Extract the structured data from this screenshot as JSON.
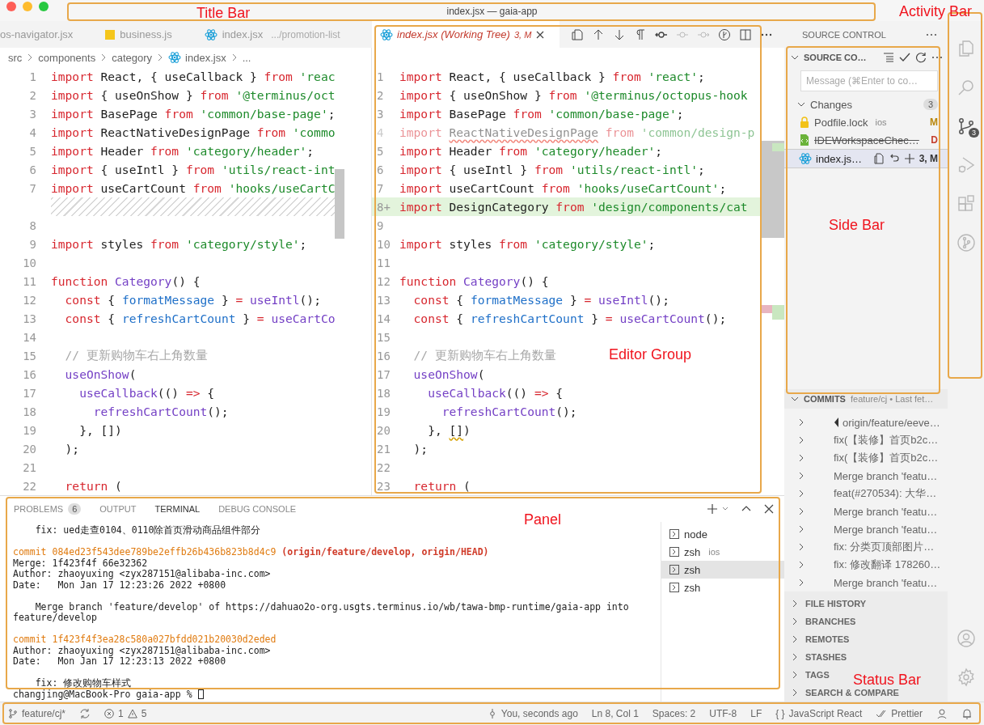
{
  "window": {
    "title": "index.jsx — gaia-app"
  },
  "editor": {
    "left_tabs": [
      {
        "label": "os-navigator.jsx",
        "kind": "plain",
        "selected": false
      },
      {
        "label": "business.js",
        "kind": "js",
        "selected": false
      },
      {
        "label": "index.jsx",
        "detail": ".../promotion-list",
        "kind": "react",
        "selected": false
      }
    ],
    "right_tab": {
      "label": "index.jsx (Working Tree)",
      "status": "3, M",
      "selected": true
    },
    "breadcrumb": [
      {
        "text": "src",
        "kind": "folder"
      },
      {
        "text": "components",
        "kind": "folder"
      },
      {
        "text": "category",
        "kind": "folder"
      },
      {
        "text": "index.jsx",
        "kind": "file"
      },
      {
        "text": "...",
        "kind": "symbol"
      }
    ],
    "left_lines": [
      {
        "n": "1",
        "kind": "code",
        "tokens": [
          {
            "kind": "keyword",
            "text": "import"
          },
          {
            "kind": "plain",
            "text": " React, { useCallback } "
          },
          {
            "kind": "keyword",
            "text": "from"
          },
          {
            "kind": "string",
            "text": " 'reac"
          }
        ]
      },
      {
        "n": "2",
        "kind": "code",
        "tokens": [
          {
            "kind": "keyword",
            "text": "import"
          },
          {
            "kind": "plain",
            "text": " { useOnShow } "
          },
          {
            "kind": "keyword",
            "text": "from"
          },
          {
            "kind": "string",
            "text": " '@terminus/oct"
          }
        ]
      },
      {
        "n": "3",
        "kind": "code",
        "tokens": [
          {
            "kind": "keyword",
            "text": "import"
          },
          {
            "kind": "plain",
            "text": " BasePage "
          },
          {
            "kind": "keyword",
            "text": "from"
          },
          {
            "kind": "string",
            "text": " 'common/base-page'"
          },
          {
            "kind": "plain",
            "text": ";"
          }
        ]
      },
      {
        "n": "4",
        "kind": "code",
        "tokens": [
          {
            "kind": "keyword",
            "text": "import"
          },
          {
            "kind": "plain",
            "text": " ReactNativeDesignPage "
          },
          {
            "kind": "keyword",
            "text": "from"
          },
          {
            "kind": "string",
            "text": " 'commo"
          }
        ]
      },
      {
        "n": "5",
        "kind": "code",
        "tokens": [
          {
            "kind": "keyword",
            "text": "import"
          },
          {
            "kind": "plain",
            "text": " Header "
          },
          {
            "kind": "keyword",
            "text": "from"
          },
          {
            "kind": "string",
            "text": " 'category/header'"
          },
          {
            "kind": "plain",
            "text": ";"
          }
        ]
      },
      {
        "n": "6",
        "kind": "code",
        "tokens": [
          {
            "kind": "keyword",
            "text": "import"
          },
          {
            "kind": "plain",
            "text": " { useIntl } "
          },
          {
            "kind": "keyword",
            "text": "from"
          },
          {
            "kind": "string",
            "text": " 'utils/react-int"
          }
        ]
      },
      {
        "n": "7",
        "kind": "code",
        "tokens": [
          {
            "kind": "keyword",
            "text": "import"
          },
          {
            "kind": "plain",
            "text": " useCartCount "
          },
          {
            "kind": "keyword",
            "text": "from"
          },
          {
            "kind": "string",
            "text": " 'hooks/useCartC"
          }
        ]
      },
      {
        "kind": "filler"
      },
      {
        "n": "8",
        "kind": "code"
      },
      {
        "n": "9",
        "kind": "code",
        "tokens": [
          {
            "kind": "keyword",
            "text": "import"
          },
          {
            "kind": "plain",
            "text": " styles "
          },
          {
            "kind": "keyword",
            "text": "from"
          },
          {
            "kind": "string",
            "text": " 'category/style'"
          },
          {
            "kind": "plain",
            "text": ";"
          }
        ]
      },
      {
        "n": "10",
        "kind": "code"
      },
      {
        "n": "11",
        "kind": "code",
        "tokens": [
          {
            "kind": "keyword",
            "text": "function"
          },
          {
            "kind": "function",
            "text": " Category"
          },
          {
            "kind": "plain",
            "text": "() {"
          }
        ]
      },
      {
        "n": "12",
        "kind": "code",
        "tokens": [
          {
            "kind": "keyword",
            "text": "  const"
          },
          {
            "kind": "plain",
            "text": " { "
          },
          {
            "kind": "variable",
            "text": "formatMessage"
          },
          {
            "kind": "plain",
            "text": " } "
          },
          {
            "kind": "keyword",
            "text": "="
          },
          {
            "kind": "function",
            "text": " useIntl"
          },
          {
            "kind": "plain",
            "text": "();"
          }
        ]
      },
      {
        "n": "13",
        "kind": "code",
        "tokens": [
          {
            "kind": "keyword",
            "text": "  const"
          },
          {
            "kind": "plain",
            "text": " { "
          },
          {
            "kind": "variable",
            "text": "refreshCartCount"
          },
          {
            "kind": "plain",
            "text": " } "
          },
          {
            "kind": "keyword",
            "text": "="
          },
          {
            "kind": "function",
            "text": " useCartCo"
          }
        ]
      },
      {
        "n": "14",
        "kind": "code"
      },
      {
        "n": "15",
        "kind": "code",
        "tokens": [
          {
            "kind": "comment",
            "text": "  // 更新购物车右上角数量"
          }
        ]
      },
      {
        "n": "16",
        "kind": "code",
        "tokens": [
          {
            "kind": "function",
            "text": "  useOnShow"
          },
          {
            "kind": "plain",
            "text": "("
          }
        ]
      },
      {
        "n": "17",
        "kind": "code",
        "tokens": [
          {
            "kind": "function",
            "text": "    useCallback"
          },
          {
            "kind": "plain",
            "text": "(() "
          },
          {
            "kind": "keyword",
            "text": "=>"
          },
          {
            "kind": "plain",
            "text": " {"
          }
        ]
      },
      {
        "n": "18",
        "kind": "code",
        "tokens": [
          {
            "kind": "function",
            "text": "      refreshCartCount"
          },
          {
            "kind": "plain",
            "text": "();"
          }
        ]
      },
      {
        "n": "19",
        "kind": "code",
        "tokens": [
          {
            "kind": "plain",
            "text": "    }, [])"
          }
        ]
      },
      {
        "n": "20",
        "kind": "code",
        "tokens": [
          {
            "kind": "plain",
            "text": "  );"
          }
        ]
      },
      {
        "n": "21",
        "kind": "code"
      },
      {
        "n": "22",
        "kind": "code",
        "tokens": [
          {
            "kind": "keyword",
            "text": "  return"
          },
          {
            "kind": "plain",
            "text": " ("
          }
        ]
      }
    ],
    "right_lines": [
      {
        "n": "1",
        "kind": "code",
        "tokens": [
          {
            "kind": "keyword",
            "text": "import"
          },
          {
            "kind": "plain",
            "text": " React, { useCallback } "
          },
          {
            "kind": "keyword",
            "text": "from"
          },
          {
            "kind": "string",
            "text": " 'react'"
          },
          {
            "kind": "plain",
            "text": ";"
          }
        ]
      },
      {
        "n": "2",
        "kind": "code",
        "tokens": [
          {
            "kind": "keyword",
            "text": "import"
          },
          {
            "kind": "plain",
            "text": " { useOnShow } "
          },
          {
            "kind": "keyword",
            "text": "from"
          },
          {
            "kind": "string",
            "text": " '@terminus/octopus-hook"
          }
        ]
      },
      {
        "n": "3",
        "kind": "code",
        "tokens": [
          {
            "kind": "keyword",
            "text": "import"
          },
          {
            "kind": "plain",
            "text": " BasePage "
          },
          {
            "kind": "keyword",
            "text": "from"
          },
          {
            "kind": "string",
            "text": " 'common/base-page'"
          },
          {
            "kind": "plain",
            "text": ";"
          }
        ]
      },
      {
        "n": "4",
        "kind": "faded",
        "tokens": [
          {
            "kind": "keyword",
            "text": "import "
          },
          {
            "kind": "error",
            "text": "ReactNativeDesignPage"
          },
          {
            "kind": "keyword",
            "text": " from"
          },
          {
            "kind": "string",
            "text": " 'common/design-p"
          }
        ]
      },
      {
        "n": "5",
        "kind": "code",
        "tokens": [
          {
            "kind": "keyword",
            "text": "import"
          },
          {
            "kind": "plain",
            "text": " Header "
          },
          {
            "kind": "keyword",
            "text": "from"
          },
          {
            "kind": "string",
            "text": " 'category/header'"
          },
          {
            "kind": "plain",
            "text": ";"
          }
        ]
      },
      {
        "n": "6",
        "kind": "code",
        "tokens": [
          {
            "kind": "keyword",
            "text": "import"
          },
          {
            "kind": "plain",
            "text": " { useIntl } "
          },
          {
            "kind": "keyword",
            "text": "from"
          },
          {
            "kind": "string",
            "text": " 'utils/react-intl'"
          },
          {
            "kind": "plain",
            "text": ";"
          }
        ]
      },
      {
        "n": "7",
        "kind": "code",
        "tokens": [
          {
            "kind": "keyword",
            "text": "import"
          },
          {
            "kind": "plain",
            "text": " useCartCount "
          },
          {
            "kind": "keyword",
            "text": "from"
          },
          {
            "kind": "string",
            "text": " 'hooks/useCartCount'"
          },
          {
            "kind": "plain",
            "text": ";"
          }
        ]
      },
      {
        "n": "8+",
        "kind": "added",
        "tokens": [
          {
            "kind": "keyword",
            "text": "import"
          },
          {
            "kind": "plain",
            "text": " DesignCategory "
          },
          {
            "kind": "keyword",
            "text": "from"
          },
          {
            "kind": "string",
            "text": " 'design/components/cat"
          }
        ]
      },
      {
        "n": "9",
        "kind": "code"
      },
      {
        "n": "10",
        "kind": "code",
        "tokens": [
          {
            "kind": "keyword",
            "text": "import"
          },
          {
            "kind": "plain",
            "text": " styles "
          },
          {
            "kind": "keyword",
            "text": "from"
          },
          {
            "kind": "string",
            "text": " 'category/style'"
          },
          {
            "kind": "plain",
            "text": ";"
          }
        ]
      },
      {
        "n": "11",
        "kind": "code"
      },
      {
        "n": "12",
        "kind": "code",
        "tokens": [
          {
            "kind": "keyword",
            "text": "function"
          },
          {
            "kind": "function",
            "text": " Category"
          },
          {
            "kind": "plain",
            "text": "() {"
          }
        ]
      },
      {
        "n": "13",
        "kind": "code",
        "tokens": [
          {
            "kind": "keyword",
            "text": "  const"
          },
          {
            "kind": "plain",
            "text": " { "
          },
          {
            "kind": "variable",
            "text": "formatMessage"
          },
          {
            "kind": "plain",
            "text": " } "
          },
          {
            "kind": "keyword",
            "text": "="
          },
          {
            "kind": "function",
            "text": " useIntl"
          },
          {
            "kind": "plain",
            "text": "();"
          }
        ]
      },
      {
        "n": "14",
        "kind": "code",
        "tokens": [
          {
            "kind": "keyword",
            "text": "  const"
          },
          {
            "kind": "plain",
            "text": " { "
          },
          {
            "kind": "variable",
            "text": "refreshCartCount"
          },
          {
            "kind": "plain",
            "text": " } "
          },
          {
            "kind": "keyword",
            "text": "="
          },
          {
            "kind": "function",
            "text": " useCartCount"
          },
          {
            "kind": "plain",
            "text": "();"
          }
        ]
      },
      {
        "n": "15",
        "kind": "code"
      },
      {
        "n": "16",
        "kind": "code",
        "tokens": [
          {
            "kind": "comment",
            "text": "  // 更新购物车右上角数量"
          }
        ]
      },
      {
        "n": "17",
        "kind": "code",
        "tokens": [
          {
            "kind": "function",
            "text": "  useOnShow"
          },
          {
            "kind": "plain",
            "text": "("
          }
        ]
      },
      {
        "n": "18",
        "kind": "code",
        "tokens": [
          {
            "kind": "function",
            "text": "    useCallback"
          },
          {
            "kind": "plain",
            "text": "(() "
          },
          {
            "kind": "keyword",
            "text": "=>"
          },
          {
            "kind": "plain",
            "text": " {"
          }
        ]
      },
      {
        "n": "19",
        "kind": "code",
        "tokens": [
          {
            "kind": "function",
            "text": "      refreshCartCount"
          },
          {
            "kind": "plain",
            "text": "();"
          }
        ]
      },
      {
        "n": "20",
        "kind": "code",
        "tokens": [
          {
            "kind": "plain",
            "text": "    }, "
          },
          {
            "kind": "warning",
            "text": "[]"
          },
          {
            "kind": "plain",
            "text": ")"
          }
        ]
      },
      {
        "n": "21",
        "kind": "code",
        "tokens": [
          {
            "kind": "plain",
            "text": "  );"
          }
        ]
      },
      {
        "n": "22",
        "kind": "code"
      },
      {
        "n": "23",
        "kind": "code",
        "tokens": [
          {
            "kind": "keyword",
            "text": "  return"
          },
          {
            "kind": "plain",
            "text": " ("
          }
        ]
      }
    ]
  },
  "sidebar": {
    "title": "SOURCE CONTROL",
    "section": "SOURCE CO…",
    "message_placeholder": "Message (⌘Enter to co…",
    "changes": {
      "label": "Changes",
      "count": "3",
      "expanded": true,
      "files": [
        {
          "name": "Podfile.lock",
          "folder": "ios",
          "status": "M",
          "kind": "lock",
          "deleted": false,
          "selected": false,
          "color": "#b8860b"
        },
        {
          "name": "IDEWorkspaceChec…",
          "status": "D",
          "kind": "settings",
          "deleted": true,
          "selected": false,
          "color": "#c5402f"
        },
        {
          "name": "index.js…",
          "status": "3, M",
          "kind": "react",
          "deleted": false,
          "selected": true,
          "color": "#333333"
        }
      ]
    },
    "commits": {
      "title": "COMMITS",
      "subtitle": "feature/cj • Last fet…",
      "expanded": true,
      "rows": [
        {
          "kind": "ref",
          "text": "origin/feature/eeve…"
        },
        {
          "kind": "commit",
          "text": "fix(【装修】首页b2c…"
        },
        {
          "kind": "commit",
          "text": "fix(【装修】首页b2c…"
        },
        {
          "kind": "commit",
          "text": "Merge branch 'featu…"
        },
        {
          "kind": "commit",
          "text": "feat(#270534): 大华…"
        },
        {
          "kind": "commit",
          "text": "Merge branch 'featu…"
        },
        {
          "kind": "commit",
          "text": "Merge branch 'featu…"
        },
        {
          "kind": "commit",
          "text": "fix: 分类页顶部图片…"
        },
        {
          "kind": "commit",
          "text": "fix: 修改翻译  178260…"
        },
        {
          "kind": "commit",
          "text": "Merge branch 'featu…"
        }
      ]
    },
    "sections": [
      {
        "label": "FILE HISTORY",
        "expanded": false
      },
      {
        "label": "BRANCHES",
        "expanded": false
      },
      {
        "label": "REMOTES",
        "expanded": false
      },
      {
        "label": "STASHES",
        "expanded": false
      },
      {
        "label": "TAGS",
        "expanded": false
      },
      {
        "label": "SEARCH & COMPARE",
        "expanded": false
      }
    ]
  },
  "activity_bar": {
    "items": [
      {
        "kind": "explorer",
        "selected": false
      },
      {
        "kind": "search",
        "selected": false
      },
      {
        "kind": "scm",
        "selected": true,
        "badge": "3"
      },
      {
        "kind": "debug",
        "selected": false
      },
      {
        "kind": "extensions",
        "selected": false
      },
      {
        "kind": "remote",
        "selected": false
      }
    ],
    "bottom": [
      {
        "kind": "account"
      },
      {
        "kind": "settings"
      }
    ]
  },
  "panel": {
    "tabs": [
      {
        "label": "PROBLEMS",
        "badge": "6",
        "selected": false
      },
      {
        "label": "OUTPUT",
        "selected": false
      },
      {
        "label": "TERMINAL",
        "selected": true
      },
      {
        "label": "DEBUG CONSOLE",
        "selected": false
      }
    ],
    "terminal_lines": [
      {
        "kind": "plain",
        "text": "    fix: ued走查0104、0110除首页滑动商品组件部分"
      },
      {
        "kind": "blank"
      },
      {
        "kind": "commit",
        "text": "commit 084ed23f543dee789be2effb26b436b823b8d4c9",
        "refs": "(origin/feature/develop, origin/HEAD)"
      },
      {
        "kind": "plain",
        "text": "Merge: 1f423f4f 66e32362"
      },
      {
        "kind": "plain",
        "text": "Author: zhaoyuxing <zyx287151@alibaba-inc.com>"
      },
      {
        "kind": "plain",
        "text": "Date:   Mon Jan 17 12:23:26 2022 +0800"
      },
      {
        "kind": "blank"
      },
      {
        "kind": "plain",
        "text": "    Merge branch 'feature/develop' of https://dahuao2o-org.usgts.terminus.io/wb/tawa-bmp-runtime/gaia-app into"
      },
      {
        "kind": "plain",
        "text": "feature/develop"
      },
      {
        "kind": "blank"
      },
      {
        "kind": "commit",
        "text": "commit 1f423f4f3ea28c580a027bfdd021b20030d2eded"
      },
      {
        "kind": "plain",
        "text": "Author: zhaoyuxing <zyx287151@alibaba-inc.com>"
      },
      {
        "kind": "plain",
        "text": "Date:   Mon Jan 17 12:23:13 2022 +0800"
      },
      {
        "kind": "blank"
      },
      {
        "kind": "plain",
        "text": "    fix: 修改购物车样式"
      },
      {
        "kind": "prompt",
        "text": "changjing@MacBook-Pro gaia-app %"
      }
    ],
    "terminals": [
      {
        "name": "node",
        "selected": false
      },
      {
        "name": "zsh",
        "folder": "ios",
        "selected": false
      },
      {
        "name": "zsh",
        "selected": true
      },
      {
        "name": "zsh",
        "selected": false
      }
    ]
  },
  "status_bar": {
    "branch": "feature/cj*",
    "errors": "1",
    "warnings": "5",
    "blame": "You, seconds ago",
    "position": "Ln 8, Col 1",
    "spaces": "Spaces: 2",
    "encoding": "UTF-8",
    "eol": "LF",
    "language_icon": "{ }",
    "language": "JavaScript React",
    "formatter": "Prettier"
  },
  "annotations": [
    {
      "label": "Title Bar"
    },
    {
      "label": "Activity Bar"
    },
    {
      "label": "Side Bar"
    },
    {
      "label": "Editor Group"
    },
    {
      "label": "Panel"
    },
    {
      "label": "Status Bar"
    }
  ]
}
